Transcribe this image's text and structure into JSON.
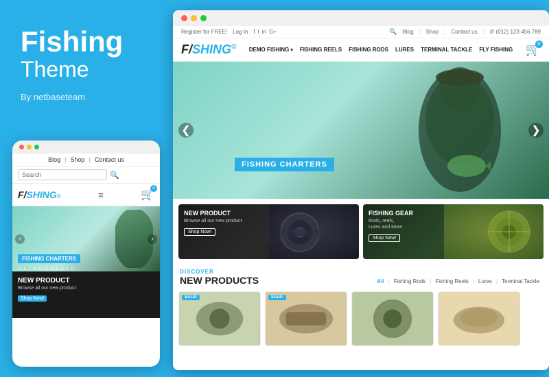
{
  "left": {
    "title_fishing": "Fishing",
    "title_theme": "Theme",
    "by": "By netbaseteam"
  },
  "mobile": {
    "dots": [
      "red",
      "yellow",
      "green"
    ],
    "topbar": {
      "blog": "Blog",
      "shop": "Shop",
      "contact": "Contact us"
    },
    "search_placeholder": "Search",
    "logo_text": "F/SHING",
    "hero_label": "FISHING CHARTERS",
    "hero_subtitle": "G E T   B O O K E D   T O ...",
    "product_title": "NEW PRODUCT",
    "product_desc": "Browse all our new product",
    "product_btn": "Shop Now!"
  },
  "desktop": {
    "utility": {
      "register": "Register for FREE!",
      "login": "Log In",
      "blog": "Blog",
      "shop": "Shop",
      "contact": "Contact us",
      "phone": "✆ (012) 123 456 789"
    },
    "logo": "F/SHING",
    "nav": {
      "demo": "DEMO FISHING",
      "reels": "FISHING REELS",
      "rods": "FISHING RODS",
      "lures": "LURES",
      "terminal": "TERMINAL TACKLE",
      "fly": "FLY FISHING"
    },
    "hero_label": "FISHING CHARTERS",
    "cards": [
      {
        "title": "NEW PRODUCT",
        "desc": "Browse all our new product",
        "btn": "Shop Now!"
      },
      {
        "title": "FISHING GEAR",
        "desc": "Rods, reels,\nLures and More",
        "btn": "Shop Now!"
      }
    ],
    "discover_label": "DISCOVER",
    "discover_title": "NEW PRODUCTS",
    "filters": [
      "All",
      "Fishing Rods",
      "Fishing Reels",
      "Lures",
      "Terminal Tackle"
    ],
    "filter_active": "All",
    "thumb_badge": "SALE!"
  }
}
